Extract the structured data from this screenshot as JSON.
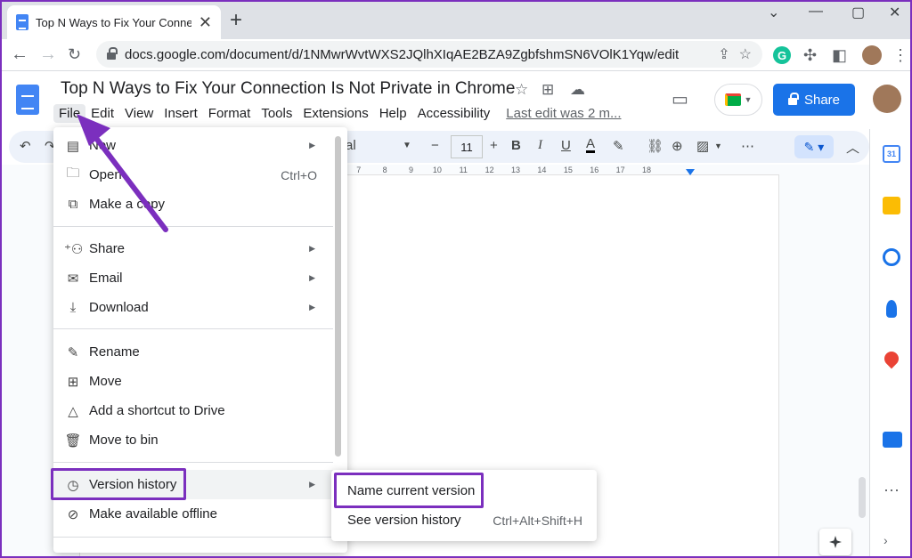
{
  "browser": {
    "tab_title": "Top N Ways to Fix Your Connectio",
    "url": "docs.google.com/document/d/1NMwrWvtWXS2JQlhXIqAE2BZA9ZgbfshmSN6VOlK1Yqw/edit"
  },
  "doc": {
    "title": "Top N Ways to Fix Your Connection Is Not Private in Chrome",
    "menus": [
      "File",
      "Edit",
      "View",
      "Insert",
      "Format",
      "Tools",
      "Extensions",
      "Help",
      "Accessibility"
    ],
    "last_edit": "Last edit was 2 m...",
    "share_label": "Share"
  },
  "format_toolbar": {
    "font_partial": "al",
    "font_size": "11"
  },
  "ruler": [
    "7",
    "8",
    "9",
    "10",
    "11",
    "12",
    "13",
    "14",
    "15",
    "16",
    "17",
    "18"
  ],
  "file_menu": {
    "items": [
      {
        "label": "New",
        "shortcut": "",
        "submenu": true
      },
      {
        "label": "Open",
        "shortcut": "Ctrl+O",
        "submenu": false
      },
      {
        "label": "Make a copy",
        "shortcut": "",
        "submenu": false
      },
      {
        "label": "Share",
        "shortcut": "",
        "submenu": true
      },
      {
        "label": "Email",
        "shortcut": "",
        "submenu": true
      },
      {
        "label": "Download",
        "shortcut": "",
        "submenu": true
      },
      {
        "label": "Rename",
        "shortcut": "",
        "submenu": false
      },
      {
        "label": "Move",
        "shortcut": "",
        "submenu": false
      },
      {
        "label": "Add a shortcut to Drive",
        "shortcut": "",
        "submenu": false
      },
      {
        "label": "Move to bin",
        "shortcut": "",
        "submenu": false
      },
      {
        "label": "Version history",
        "shortcut": "",
        "submenu": true
      },
      {
        "label": "Make available offline",
        "shortcut": "",
        "submenu": false
      }
    ]
  },
  "version_submenu": {
    "items": [
      {
        "label": "Name current version",
        "shortcut": ""
      },
      {
        "label": "See version history",
        "shortcut": "Ctrl+Alt+Shift+H"
      }
    ]
  },
  "side_panel": {
    "calendar_day": "31"
  },
  "colors": {
    "accent": "#1a73e8",
    "annotation": "#7b2fbe"
  }
}
